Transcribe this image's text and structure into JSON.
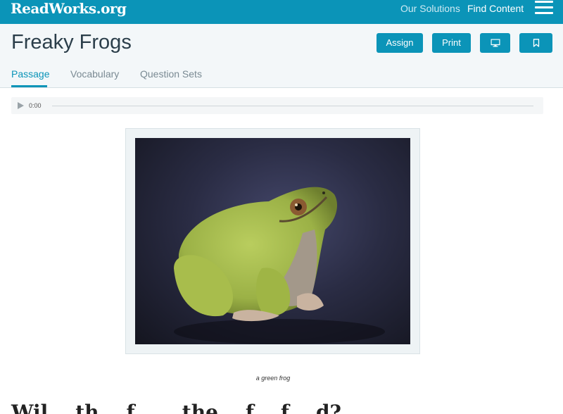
{
  "brand": {
    "logo_text": "ReadWorks.org"
  },
  "nav": {
    "solutions": "Our Solutions",
    "find_content": "Find Content"
  },
  "header": {
    "title": "Freaky Frogs",
    "assign_label": "Assign",
    "print_label": "Print"
  },
  "tabs": [
    {
      "label": "Passage",
      "active": true
    },
    {
      "label": "Vocabulary",
      "active": false
    },
    {
      "label": "Question Sets",
      "active": false
    }
  ],
  "audio": {
    "time": "0:00"
  },
  "figure": {
    "caption": "a green frog"
  },
  "article": {
    "heading": "Wil... th... f... ...the... f... f... d?"
  },
  "colors": {
    "brand": "#0b94b8",
    "header_bg": "#f3f7f9",
    "title": "#2b3e4a"
  },
  "icons": {
    "menu": "hamburger-icon",
    "present": "monitor-icon",
    "bookmark": "bookmark-icon",
    "play": "play-icon"
  }
}
